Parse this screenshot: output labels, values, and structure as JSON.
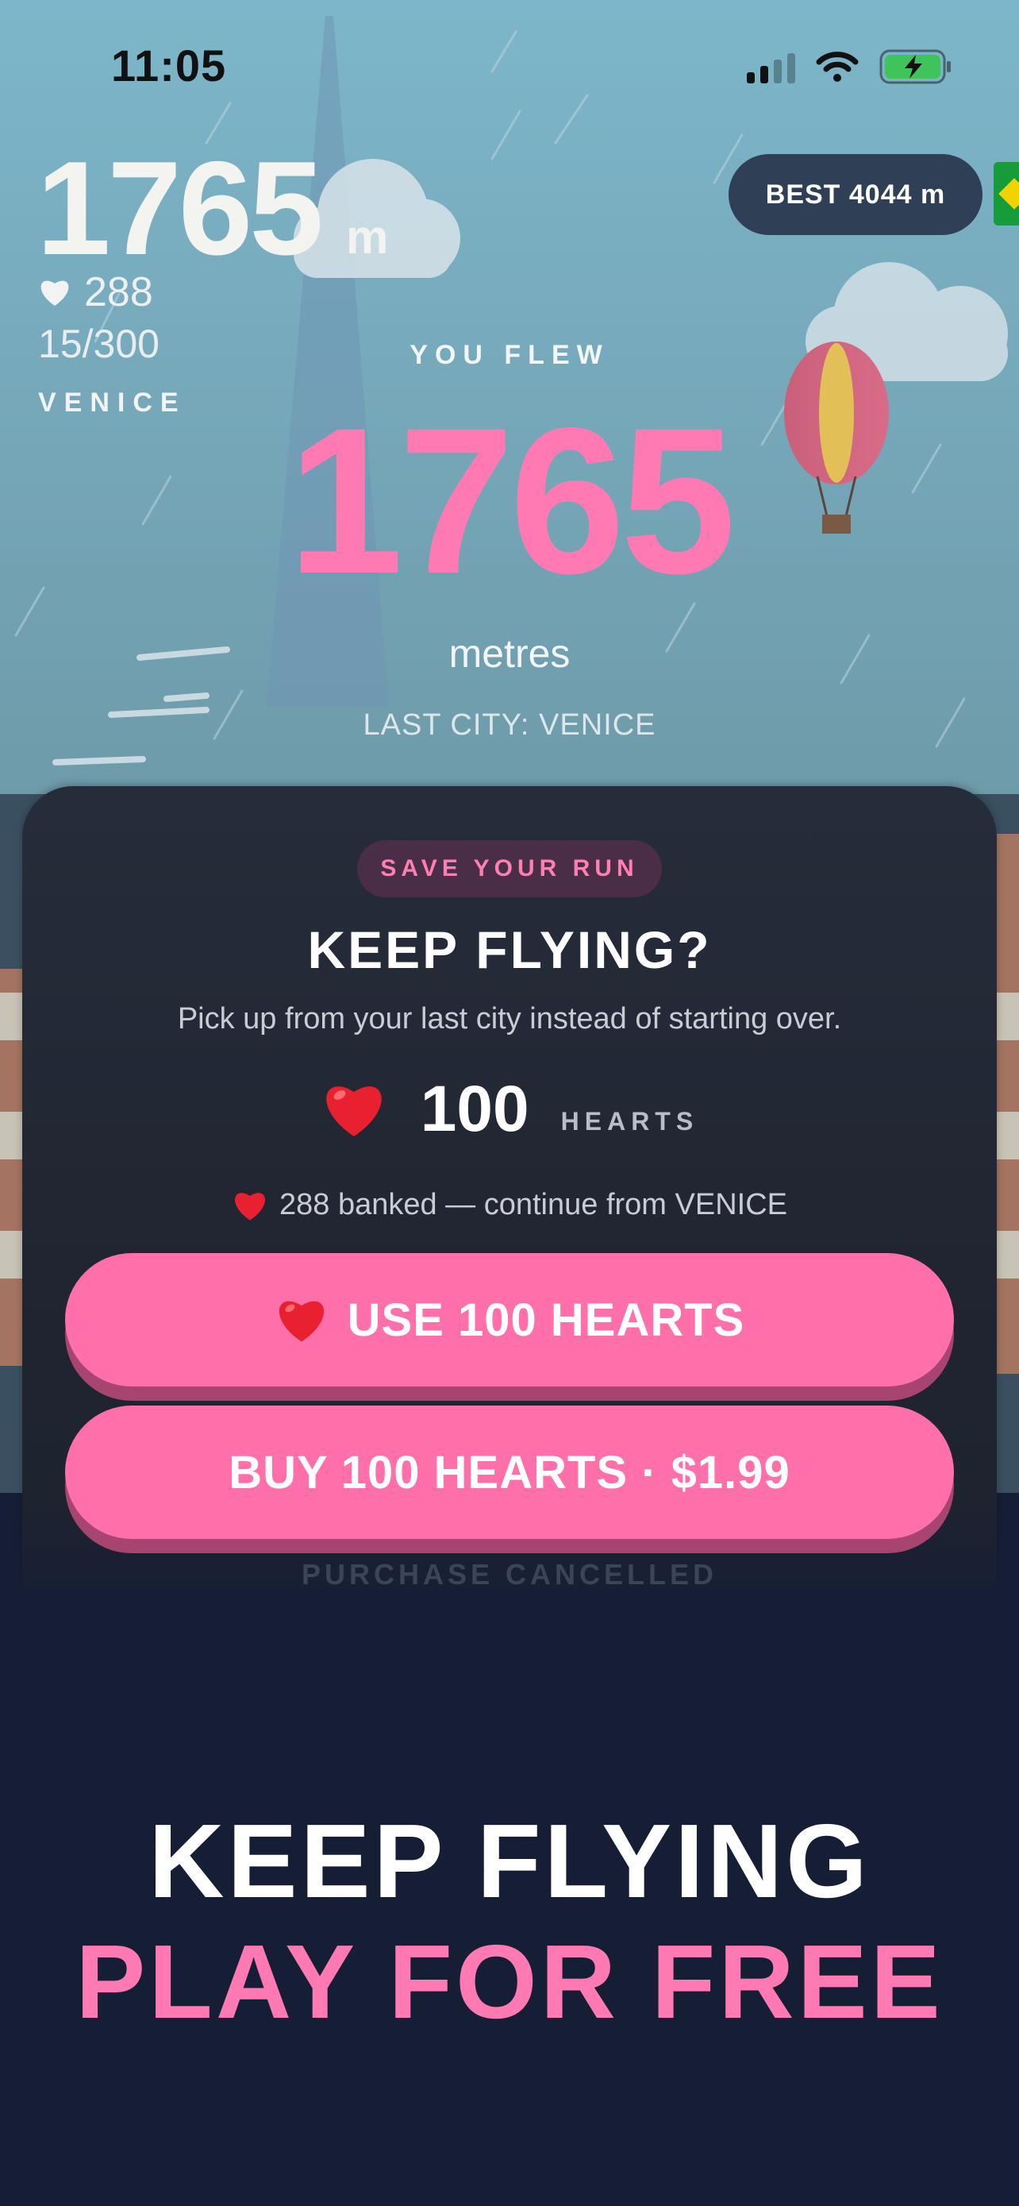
{
  "status_bar": {
    "time": "11:05"
  },
  "hud": {
    "distance": "1765",
    "unit": "m",
    "hearts": "288",
    "progress": "15/300",
    "city": "VENICE"
  },
  "best": {
    "label": "BEST 4044 m"
  },
  "result": {
    "eyebrow": "YOU FLEW",
    "distance": "1765",
    "unit": "metres",
    "last_city": "LAST CITY: VENICE"
  },
  "modal": {
    "tag": "SAVE YOUR RUN",
    "title": "KEEP FLYING?",
    "subtitle": "Pick up from your last city instead of starting over.",
    "cost": "100",
    "cost_unit": "HEARTS",
    "banked": "288 banked — continue from VENICE",
    "use_button": "USE 100 HEARTS",
    "buy_button": "BUY 100 HEARTS · $1.99",
    "status": "PURCHASE CANCELLED"
  },
  "promo": {
    "line1": "KEEP FLYING",
    "line2": "PLAY FOR FREE"
  },
  "colors": {
    "accent": "#ff6fa9",
    "accent_text": "#ff7ab2",
    "panel": "#212634",
    "navy": "#161e36",
    "sky": "#7fb4c8"
  },
  "icons": [
    "signal-icon",
    "wifi-icon",
    "battery-charging-icon",
    "heart-icon",
    "flag-icon",
    "hot-air-balloon",
    "cloud"
  ]
}
